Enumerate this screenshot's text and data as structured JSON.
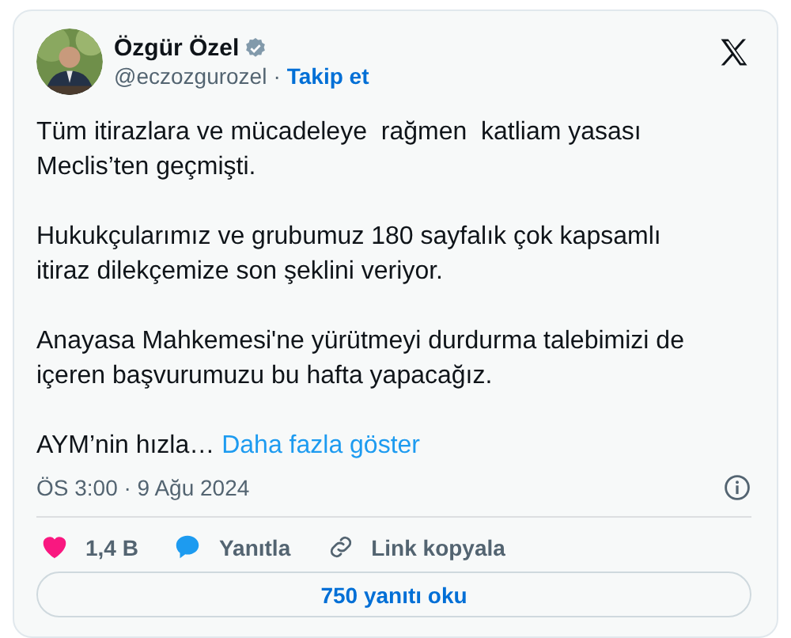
{
  "author": {
    "name": "Özgür Özel",
    "verified": true,
    "handle": "@eczozgurozel",
    "separator": "·",
    "follow": "Takip et"
  },
  "paragraphs": [
    {
      "text": "Tüm itirazlara ve mücadeleye  rağmen  katliam yasası Meclis’ten geçmişti."
    },
    {
      "text": "Hukukçularımız ve grubumuz 180 sayfalık çok kapsamlı itiraz dilekçemize son şeklini veriyor."
    },
    {
      "text": "Anayasa Mahkemesi'ne yürütmeyi durdurma talebimizi de içeren başvurumuzu bu hafta yapacağız."
    },
    {
      "text": "AYM’nin hızla…",
      "more": "Daha fazla göster"
    }
  ],
  "timestamp": "ÖS 3:00 · 9 Ağu 2024",
  "actions": [
    {
      "kind": "like",
      "label": "1,4 B"
    },
    {
      "kind": "reply",
      "label": "Yanıtla"
    },
    {
      "kind": "link",
      "label": "Link kopyala"
    }
  ],
  "read_replies": "750 yanıtı oku"
}
